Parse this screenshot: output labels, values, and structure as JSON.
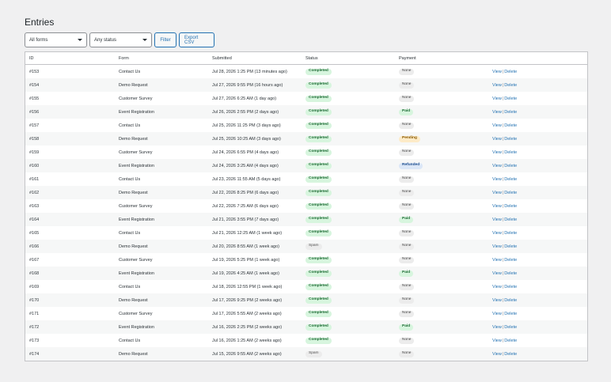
{
  "page": {
    "title": "Entries"
  },
  "toolbar": {
    "forms_select": "All forms",
    "status_select": "Any status",
    "filter_label": "Filter",
    "export_label": "Export CSV"
  },
  "columns": [
    "ID",
    "Form",
    "Submitted",
    "Status",
    "Payment",
    ""
  ],
  "actions": {
    "view": "View",
    "sep": "|",
    "delete": "Delete"
  },
  "rows": [
    {
      "id": "#153",
      "form": "Contact Us",
      "submitted": "Jul 28, 2026 1:25 PM (13 minutes ago)",
      "status": "Completed",
      "payment": "None"
    },
    {
      "id": "#154",
      "form": "Demo Request",
      "submitted": "Jul 27, 2026 9:55 PM (16 hours ago)",
      "status": "Completed",
      "payment": "None"
    },
    {
      "id": "#155",
      "form": "Customer Survey",
      "submitted": "Jul 27, 2026 6:25 AM (1 day ago)",
      "status": "Completed",
      "payment": "None"
    },
    {
      "id": "#156",
      "form": "Event Registration",
      "submitted": "Jul 26, 2026 2:55 PM (2 days ago)",
      "status": "Completed",
      "payment": "Paid"
    },
    {
      "id": "#157",
      "form": "Contact Us",
      "submitted": "Jul 25, 2026 11:25 PM (3 days ago)",
      "status": "Completed",
      "payment": "None"
    },
    {
      "id": "#158",
      "form": "Demo Request",
      "submitted": "Jul 25, 2026 10:25 AM (3 days ago)",
      "status": "Completed",
      "payment": "Pending"
    },
    {
      "id": "#159",
      "form": "Customer Survey",
      "submitted": "Jul 24, 2026 6:55 PM (4 days ago)",
      "status": "Completed",
      "payment": "None"
    },
    {
      "id": "#160",
      "form": "Event Registration",
      "submitted": "Jul 24, 2026 3:25 AM (4 days ago)",
      "status": "Completed",
      "payment": "Refunded"
    },
    {
      "id": "#161",
      "form": "Contact Us",
      "submitted": "Jul 23, 2026 11:55 AM (5 days ago)",
      "status": "Completed",
      "payment": "None"
    },
    {
      "id": "#162",
      "form": "Demo Request",
      "submitted": "Jul 22, 2026 8:25 PM (6 days ago)",
      "status": "Completed",
      "payment": "None"
    },
    {
      "id": "#163",
      "form": "Customer Survey",
      "submitted": "Jul 22, 2026 7:25 AM (6 days ago)",
      "status": "Completed",
      "payment": "None"
    },
    {
      "id": "#164",
      "form": "Event Registration",
      "submitted": "Jul 21, 2026 3:55 PM (7 days ago)",
      "status": "Completed",
      "payment": "Paid"
    },
    {
      "id": "#165",
      "form": "Contact Us",
      "submitted": "Jul 21, 2026 12:25 AM (1 week ago)",
      "status": "Completed",
      "payment": "None"
    },
    {
      "id": "#166",
      "form": "Demo Request",
      "submitted": "Jul 20, 2026 8:55 AM (1 week ago)",
      "status": "Spam",
      "payment": "None"
    },
    {
      "id": "#167",
      "form": "Customer Survey",
      "submitted": "Jul 19, 2026 5:25 PM (1 week ago)",
      "status": "Completed",
      "payment": "None"
    },
    {
      "id": "#168",
      "form": "Event Registration",
      "submitted": "Jul 19, 2026 4:25 AM (1 week ago)",
      "status": "Completed",
      "payment": "Paid"
    },
    {
      "id": "#169",
      "form": "Contact Us",
      "submitted": "Jul 18, 2026 12:55 PM (1 week ago)",
      "status": "Completed",
      "payment": "None"
    },
    {
      "id": "#170",
      "form": "Demo Request",
      "submitted": "Jul 17, 2026 9:25 PM (2 weeks ago)",
      "status": "Completed",
      "payment": "None"
    },
    {
      "id": "#171",
      "form": "Customer Survey",
      "submitted": "Jul 17, 2026 5:55 AM (2 weeks ago)",
      "status": "Completed",
      "payment": "None"
    },
    {
      "id": "#172",
      "form": "Event Registration",
      "submitted": "Jul 16, 2026 2:25 PM (2 weeks ago)",
      "status": "Completed",
      "payment": "Paid"
    },
    {
      "id": "#173",
      "form": "Contact Us",
      "submitted": "Jul 16, 2026 1:25 AM (2 weeks ago)",
      "status": "Completed",
      "payment": "None"
    },
    {
      "id": "#174",
      "form": "Demo Request",
      "submitted": "Jul 15, 2026 9:55 AM (2 weeks ago)",
      "status": "Spam",
      "payment": "None"
    }
  ]
}
